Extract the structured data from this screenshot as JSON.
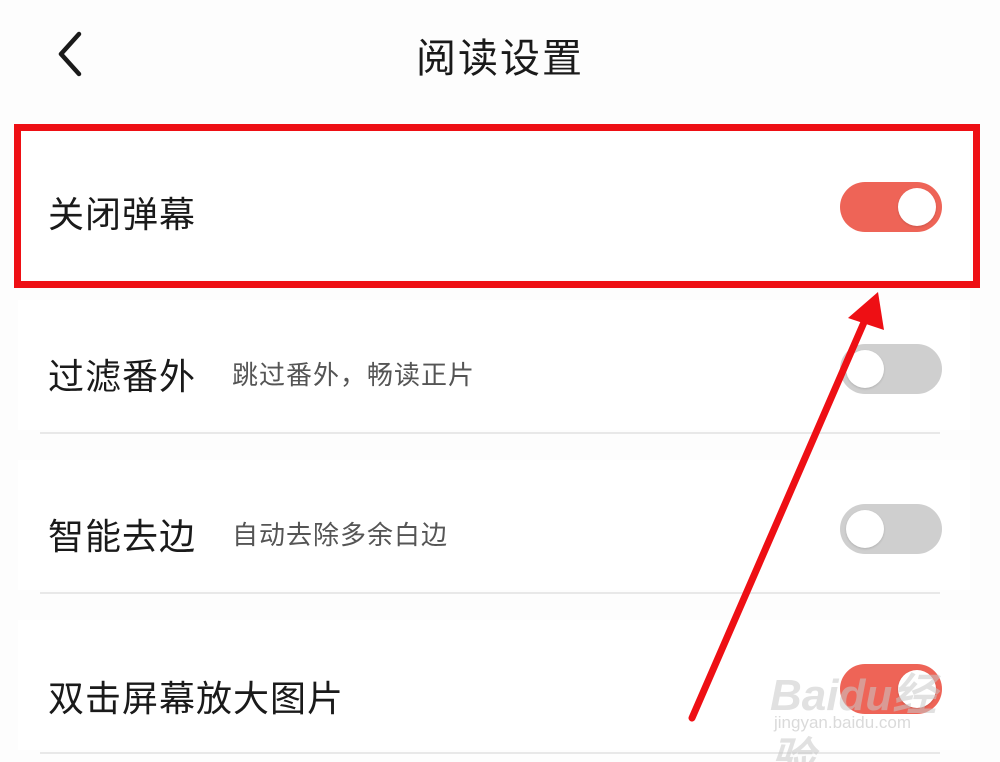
{
  "header": {
    "title": "阅读设置",
    "back_icon": "chevron-left-icon"
  },
  "settings": [
    {
      "label": "关闭弹幕",
      "desc": "",
      "enabled": true
    },
    {
      "label": "过滤番外",
      "desc": "跳过番外，畅读正片",
      "enabled": false
    },
    {
      "label": "智能去边",
      "desc": "自动去除多余白边",
      "enabled": false
    },
    {
      "label": "双击屏幕放大图片",
      "desc": "",
      "enabled": true
    }
  ],
  "colors": {
    "toggle_on": "#ee6457",
    "toggle_off": "#cfcfcf",
    "annotation": "#ee0f14"
  },
  "watermark": {
    "brand": "Baidu经验",
    "url": "jingyan.baidu.com"
  }
}
